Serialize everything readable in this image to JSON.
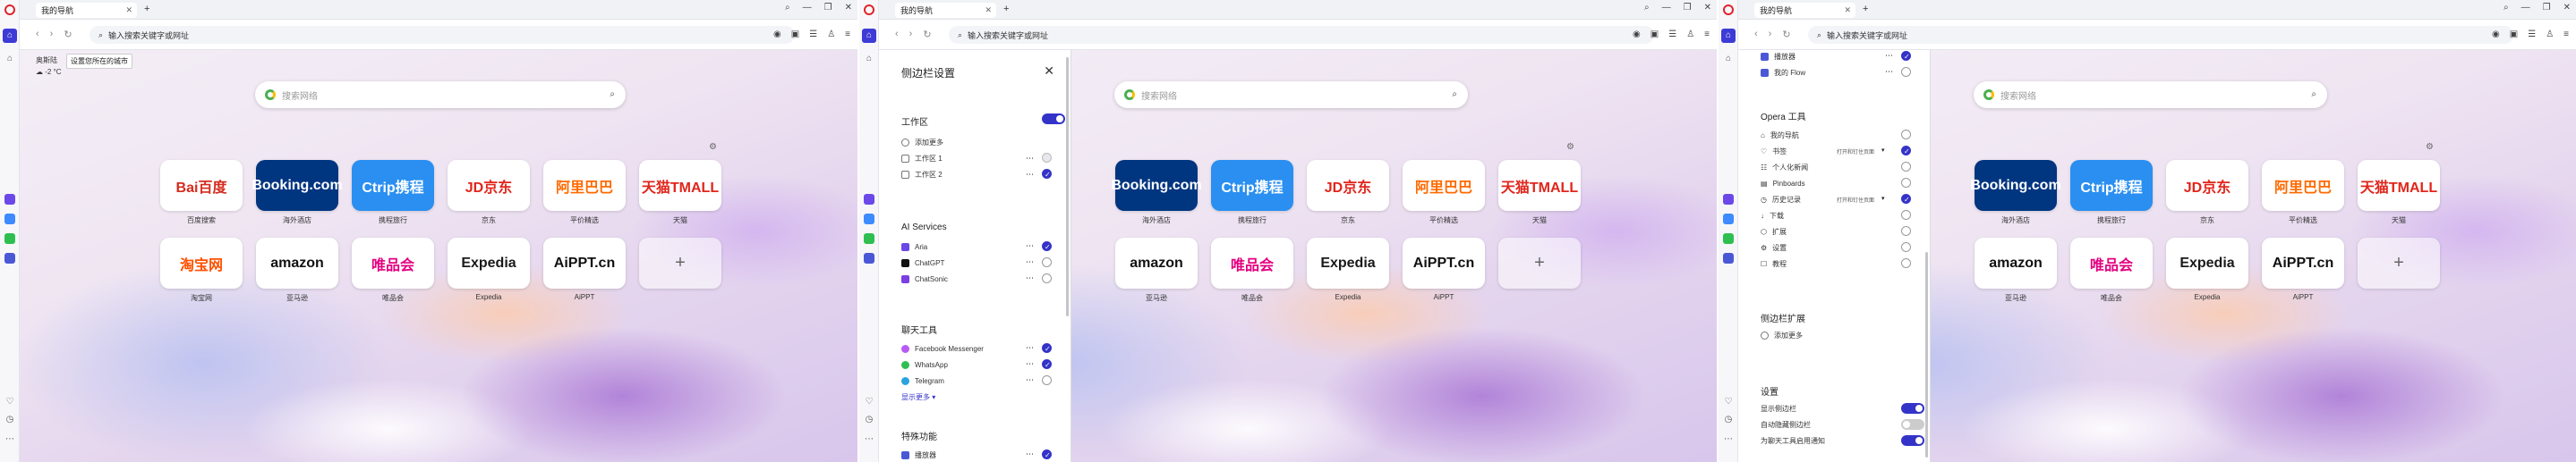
{
  "browser": {
    "tab_title": "我的导航",
    "url_placeholder": "输入搜索关键字或网址",
    "new_tab": "+",
    "win_controls": [
      "⌕",
      "—",
      "❐",
      "✕"
    ]
  },
  "weather": {
    "city": "奥斯陆",
    "temp": "-2 °C",
    "tooltip": "设置您所在的城市"
  },
  "search": {
    "placeholder": "搜索网络"
  },
  "speed_dial": {
    "row1": [
      {
        "label": "百度搜索",
        "logo": "Bai百度",
        "color": "#d52b1e"
      },
      {
        "label": "海外酒店",
        "logo": "Booking.com",
        "color": "#ffffff"
      },
      {
        "label": "携程旅行",
        "logo": "Ctrip携程",
        "color": "#ffffff"
      },
      {
        "label": "京东",
        "logo": "JD京东",
        "color": "#e1251b"
      },
      {
        "label": "平价精选",
        "logo": "阿里巴巴",
        "color": "#ff6a00"
      },
      {
        "label": "天猫",
        "logo": "天猫TMALL",
        "color": "#e1251b"
      }
    ],
    "row2": [
      {
        "label": "淘宝网",
        "logo": "淘宝网",
        "color": "#ff5000"
      },
      {
        "label": "亚马逊",
        "logo": "amazon",
        "color": "#111111"
      },
      {
        "label": "唯品会",
        "logo": "唯品会",
        "color": "#e4007f"
      },
      {
        "label": "Expedia",
        "logo": "Expedia",
        "color": "#1a1a1a"
      },
      {
        "label": "AiPPT",
        "logo": "AiPPT.cn",
        "color": "#111111"
      },
      {
        "label": "",
        "logo": "+",
        "color": "#666666"
      }
    ]
  },
  "sidebar_settings": {
    "title": "侧边栏设置",
    "workspaces": {
      "header": "工作区",
      "add": "添加更多",
      "items": [
        "工作区 1",
        "工作区 2"
      ]
    },
    "ai": {
      "header": "AI Services",
      "items": [
        "Aria",
        "ChatGPT",
        "ChatSonic"
      ]
    },
    "chat": {
      "header": "聊天工具",
      "items": [
        "Facebook Messenger",
        "WhatsApp",
        "Telegram"
      ],
      "show_more": "显示更多 ▾"
    },
    "special": {
      "header": "特殊功能",
      "items": [
        "播放器",
        "我的 Flow"
      ]
    },
    "opera": {
      "header": "Opera 工具",
      "pin_label": "打开和钉住页面",
      "items": [
        "我的导航",
        "书签",
        "个人化新闻",
        "Pinboards",
        "历史记录",
        "下载",
        "扩展",
        "设置",
        "教程"
      ]
    },
    "extensions": {
      "header": "侧边栏扩展",
      "add": "添加更多"
    },
    "settings": {
      "header": "设置",
      "items": [
        "显示侧边栏",
        "自动隐藏侧边栏",
        "为聊天工具启用通知"
      ]
    }
  },
  "colors": {
    "accent": "#3433c8",
    "opera_red": "#e0232b"
  }
}
